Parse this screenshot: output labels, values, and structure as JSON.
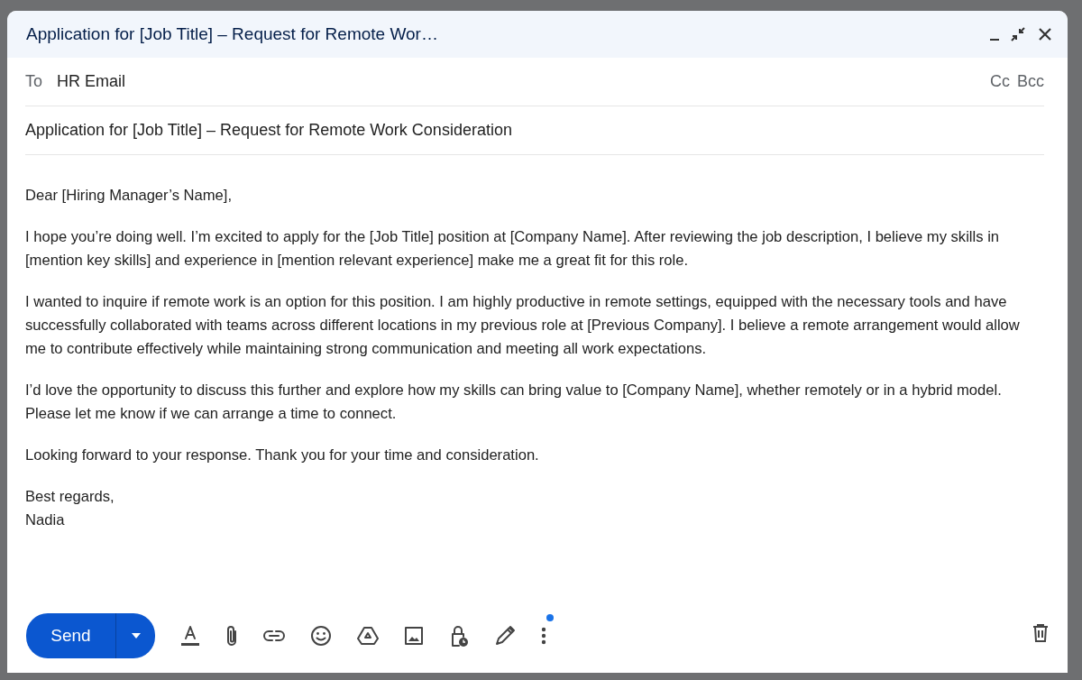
{
  "window": {
    "title": "Application for [Job Title] – Request for Remote Wor…"
  },
  "to": {
    "label": "To",
    "value": "HR Email",
    "cc": "Cc",
    "bcc": "Bcc"
  },
  "subject": "Application for [Job Title] – Request for Remote Work Consideration",
  "body": [
    "Dear [Hiring Manager’s Name],",
    "I hope you’re doing well. I’m excited to apply for the [Job Title] position at [Company Name]. After reviewing the job description, I believe my skills in [mention key skills] and experience in [mention relevant experience] make me a great fit for this role.",
    "I wanted to inquire if remote work is an option for this position. I am highly productive in remote settings, equipped with the necessary tools and have successfully collaborated with teams across different locations in my previous role at [Previous Company]. I believe a remote arrangement would allow me to contribute effectively while maintaining strong communication and meeting all work expectations.",
    "I’d love the opportunity to discuss this further and explore how my skills can bring value to [Company Name], whether remotely or in a hybrid model. Please let me know if we can arrange a time to connect.",
    "Looking forward to your response. Thank you for your time and consideration."
  ],
  "signature": [
    "Best regards,",
    "Nadia"
  ],
  "toolbar": {
    "send": "Send",
    "more_options_badge": true
  }
}
